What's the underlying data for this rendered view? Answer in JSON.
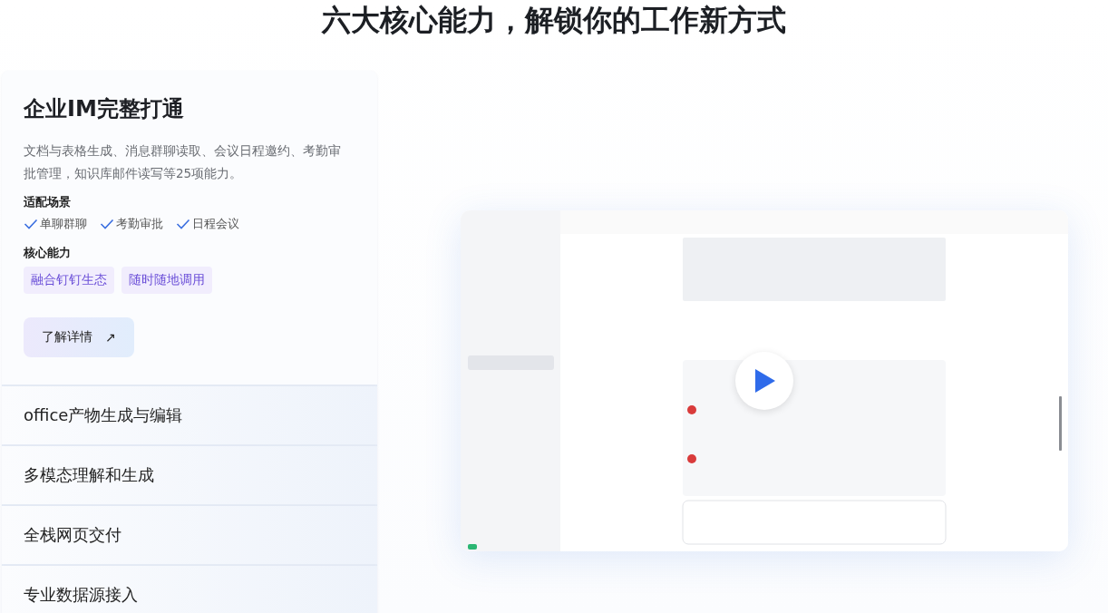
{
  "heading": "六大核心能力，解锁你的工作新方式",
  "features": [
    {
      "title": "企业IM完整打通",
      "expanded": true,
      "description": "文档与表格生成、消息群聊读取、会议日程邀约、考勤审批管理，知识库邮件读写等25项能力。",
      "scenes_label": "适配场景",
      "scenes": [
        "单聊群聊",
        "考勤审批",
        "日程会议"
      ],
      "abilities_label": "核心能力",
      "abilities": [
        "融合钉钉生态",
        "随时随地调用"
      ],
      "button": {
        "label": "了解详情",
        "icon": "↗"
      }
    },
    {
      "title": "office产物生成与编辑",
      "expanded": false
    },
    {
      "title": "多模态理解和生成",
      "expanded": false
    },
    {
      "title": "全栈网页交付",
      "expanded": false
    },
    {
      "title": "专业数据源接入",
      "expanded": false
    }
  ]
}
